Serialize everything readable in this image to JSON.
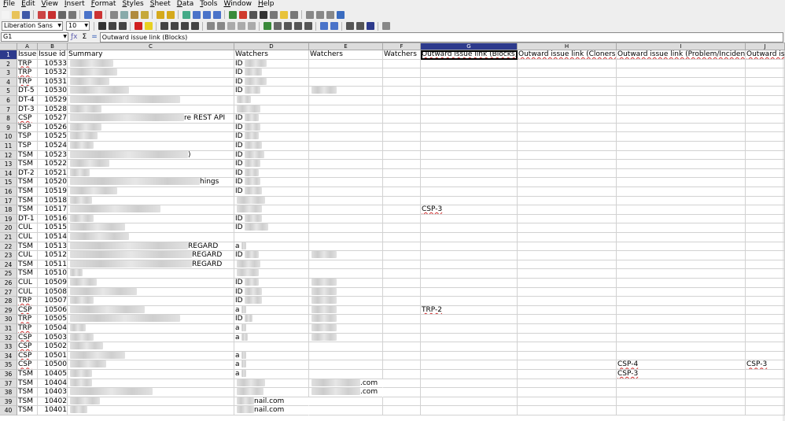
{
  "menu": [
    "File",
    "Edit",
    "View",
    "Insert",
    "Format",
    "Styles",
    "Sheet",
    "Data",
    "Tools",
    "Window",
    "Help"
  ],
  "toolbar": {
    "font_name": "Liberation Sans",
    "font_size": "10"
  },
  "formula_bar": {
    "cell_ref": "G1",
    "sigma": "Σ",
    "equals": "=",
    "content": "Outward issue link (Blocks)"
  },
  "grid": {
    "columns": [
      "A",
      "B",
      "C",
      "D",
      "E",
      "F",
      "G",
      "H",
      "I",
      "J"
    ],
    "selected_column": "G",
    "selected_row": 1,
    "header": [
      "Issue",
      "Issue id",
      "Summary",
      "Watchers",
      "Watchers",
      "Watchers",
      "Outward issue link (Blocks)",
      "Outward issue link (Cloners)",
      "Outward issue link (Problem/Incident)",
      "Outward issue link"
    ],
    "rows": [
      {
        "n": "2",
        "a": "TRP",
        "b": "10533",
        "c": "",
        "d": "ID",
        "e": "",
        "g": "",
        "h": "",
        "i": "",
        "j": ""
      },
      {
        "n": "3",
        "a": "TRP",
        "b": "10532",
        "c": "",
        "d": "ID",
        "e": "",
        "g": "",
        "h": "",
        "i": "",
        "j": ""
      },
      {
        "n": "4",
        "a": "TRP",
        "b": "10531",
        "c": "",
        "d": "ID",
        "e": "",
        "g": "",
        "h": "",
        "i": "",
        "j": ""
      },
      {
        "n": "5",
        "a": "DT-5",
        "b": "10530",
        "c": "",
        "d": "ID",
        "e": "",
        "g": "",
        "h": "",
        "i": "",
        "j": ""
      },
      {
        "n": "6",
        "a": "DT-4",
        "b": "10529",
        "c": "",
        "d": "",
        "e": "",
        "g": "",
        "h": "",
        "i": "",
        "j": ""
      },
      {
        "n": "7",
        "a": "DT-3",
        "b": "10528",
        "c": "",
        "d": "",
        "e": "",
        "g": "",
        "h": "",
        "i": "",
        "j": ""
      },
      {
        "n": "8",
        "a": "CSP",
        "b": "10527",
        "c": "re REST API",
        "d": "ID",
        "e": "",
        "g": "",
        "h": "",
        "i": "",
        "j": ""
      },
      {
        "n": "9",
        "a": "TSP",
        "b": "10526",
        "c": "",
        "d": "ID",
        "e": "",
        "g": "",
        "h": "",
        "i": "",
        "j": ""
      },
      {
        "n": "10",
        "a": "TSP",
        "b": "10525",
        "c": "",
        "d": "ID",
        "e": "",
        "g": "",
        "h": "",
        "i": "",
        "j": ""
      },
      {
        "n": "11",
        "a": "TSP",
        "b": "10524",
        "c": "",
        "d": "ID",
        "e": "",
        "g": "",
        "h": "",
        "i": "",
        "j": ""
      },
      {
        "n": "12",
        "a": "TSM",
        "b": "10523",
        "c": ")",
        "d": "ID",
        "e": "",
        "g": "",
        "h": "",
        "i": "",
        "j": ""
      },
      {
        "n": "13",
        "a": "TSM",
        "b": "10522",
        "c": "",
        "d": "ID",
        "e": "",
        "g": "",
        "h": "",
        "i": "",
        "j": ""
      },
      {
        "n": "14",
        "a": "DT-2",
        "b": "10521",
        "c": "",
        "d": "ID",
        "e": "",
        "g": "",
        "h": "",
        "i": "",
        "j": ""
      },
      {
        "n": "15",
        "a": "TSM",
        "b": "10520",
        "c": "hings",
        "d": "ID",
        "e": "",
        "g": "",
        "h": "",
        "i": "",
        "j": ""
      },
      {
        "n": "16",
        "a": "TSM",
        "b": "10519",
        "c": "",
        "d": "ID",
        "e": "",
        "g": "",
        "h": "",
        "i": "",
        "j": ""
      },
      {
        "n": "17",
        "a": "TSM",
        "b": "10518",
        "c": "",
        "d": "",
        "e": "",
        "g": "",
        "h": "",
        "i": "",
        "j": ""
      },
      {
        "n": "18",
        "a": "TSM",
        "b": "10517",
        "c": "",
        "d": "",
        "e": "",
        "g": "CSP-3",
        "h": "",
        "i": "",
        "j": ""
      },
      {
        "n": "19",
        "a": "DT-1",
        "b": "10516",
        "c": "",
        "d": "ID",
        "e": "",
        "g": "",
        "h": "",
        "i": "",
        "j": ""
      },
      {
        "n": "20",
        "a": "CUL",
        "b": "10515",
        "c": "",
        "d": "ID",
        "e": "",
        "g": "",
        "h": "",
        "i": "",
        "j": ""
      },
      {
        "n": "21",
        "a": "CUL",
        "b": "10514",
        "c": "",
        "d": "",
        "e": "",
        "g": "",
        "h": "",
        "i": "",
        "j": ""
      },
      {
        "n": "22",
        "a": "TSM",
        "b": "10513",
        "c": "REGARD",
        "d": "a",
        "e": "",
        "g": "",
        "h": "",
        "i": "",
        "j": ""
      },
      {
        "n": "23",
        "a": "CUL",
        "b": "10512",
        "c": "REGARD",
        "d": "ID",
        "e": "",
        "g": "",
        "h": "",
        "i": "",
        "j": ""
      },
      {
        "n": "24",
        "a": "TSM",
        "b": "10511",
        "c": "REGARD",
        "d": "",
        "e": "",
        "g": "",
        "h": "",
        "i": "",
        "j": ""
      },
      {
        "n": "25",
        "a": "TSM",
        "b": "10510",
        "c": "",
        "d": "",
        "e": "",
        "g": "",
        "h": "",
        "i": "",
        "j": ""
      },
      {
        "n": "26",
        "a": "CUL",
        "b": "10509",
        "c": "",
        "d": "ID",
        "e": "",
        "g": "",
        "h": "",
        "i": "",
        "j": ""
      },
      {
        "n": "27",
        "a": "CUL",
        "b": "10508",
        "c": "",
        "d": "ID",
        "e": "",
        "g": "",
        "h": "",
        "i": "",
        "j": ""
      },
      {
        "n": "28",
        "a": "TRP",
        "b": "10507",
        "c": "",
        "d": "ID",
        "e": "",
        "g": "",
        "h": "",
        "i": "",
        "j": ""
      },
      {
        "n": "29",
        "a": "CSP",
        "b": "10506",
        "c": "",
        "d": "a",
        "e": "",
        "g": "TRP-2",
        "h": "",
        "i": "",
        "j": ""
      },
      {
        "n": "30",
        "a": "TRP",
        "b": "10505",
        "c": "",
        "d": "ID",
        "e": "",
        "g": "",
        "h": "",
        "i": "",
        "j": ""
      },
      {
        "n": "31",
        "a": "TRP",
        "b": "10504",
        "c": "",
        "d": "a",
        "e": "",
        "g": "",
        "h": "",
        "i": "",
        "j": ""
      },
      {
        "n": "32",
        "a": "CSP",
        "b": "10503",
        "c": "",
        "d": "a",
        "e": "",
        "g": "",
        "h": "",
        "i": "",
        "j": ""
      },
      {
        "n": "33",
        "a": "CSP",
        "b": "10502",
        "c": "",
        "d": "",
        "e": "",
        "g": "",
        "h": "",
        "i": "",
        "j": ""
      },
      {
        "n": "34",
        "a": "CSP",
        "b": "10501",
        "c": "",
        "d": "a",
        "e": "",
        "g": "",
        "h": "",
        "i": "",
        "j": ""
      },
      {
        "n": "35",
        "a": "CSP",
        "b": "10500",
        "c": "",
        "d": "a",
        "e": "",
        "g": "",
        "h": "",
        "i": "CSP-4",
        "j": "CSP-3"
      },
      {
        "n": "36",
        "a": "TSM",
        "b": "10405",
        "c": "",
        "d": "a",
        "e": "",
        "g": "",
        "h": "",
        "i": "CSP-3",
        "j": ""
      },
      {
        "n": "37",
        "a": "TSM",
        "b": "10404",
        "c": "",
        "d": "",
        "e": ".com",
        "g": "",
        "h": "",
        "i": "",
        "j": ""
      },
      {
        "n": "38",
        "a": "TSM",
        "b": "10403",
        "c": "",
        "d": "",
        "e": ".com",
        "g": "",
        "h": "",
        "i": "",
        "j": ""
      },
      {
        "n": "39",
        "a": "TSM",
        "b": "10402",
        "c": "",
        "d": "nail.com",
        "e": "",
        "g": "",
        "h": "",
        "i": "",
        "j": ""
      },
      {
        "n": "40",
        "a": "TSM",
        "b": "10401",
        "c": "",
        "d": "nail.com",
        "e": "",
        "g": "",
        "h": "",
        "i": "",
        "j": ""
      }
    ]
  }
}
